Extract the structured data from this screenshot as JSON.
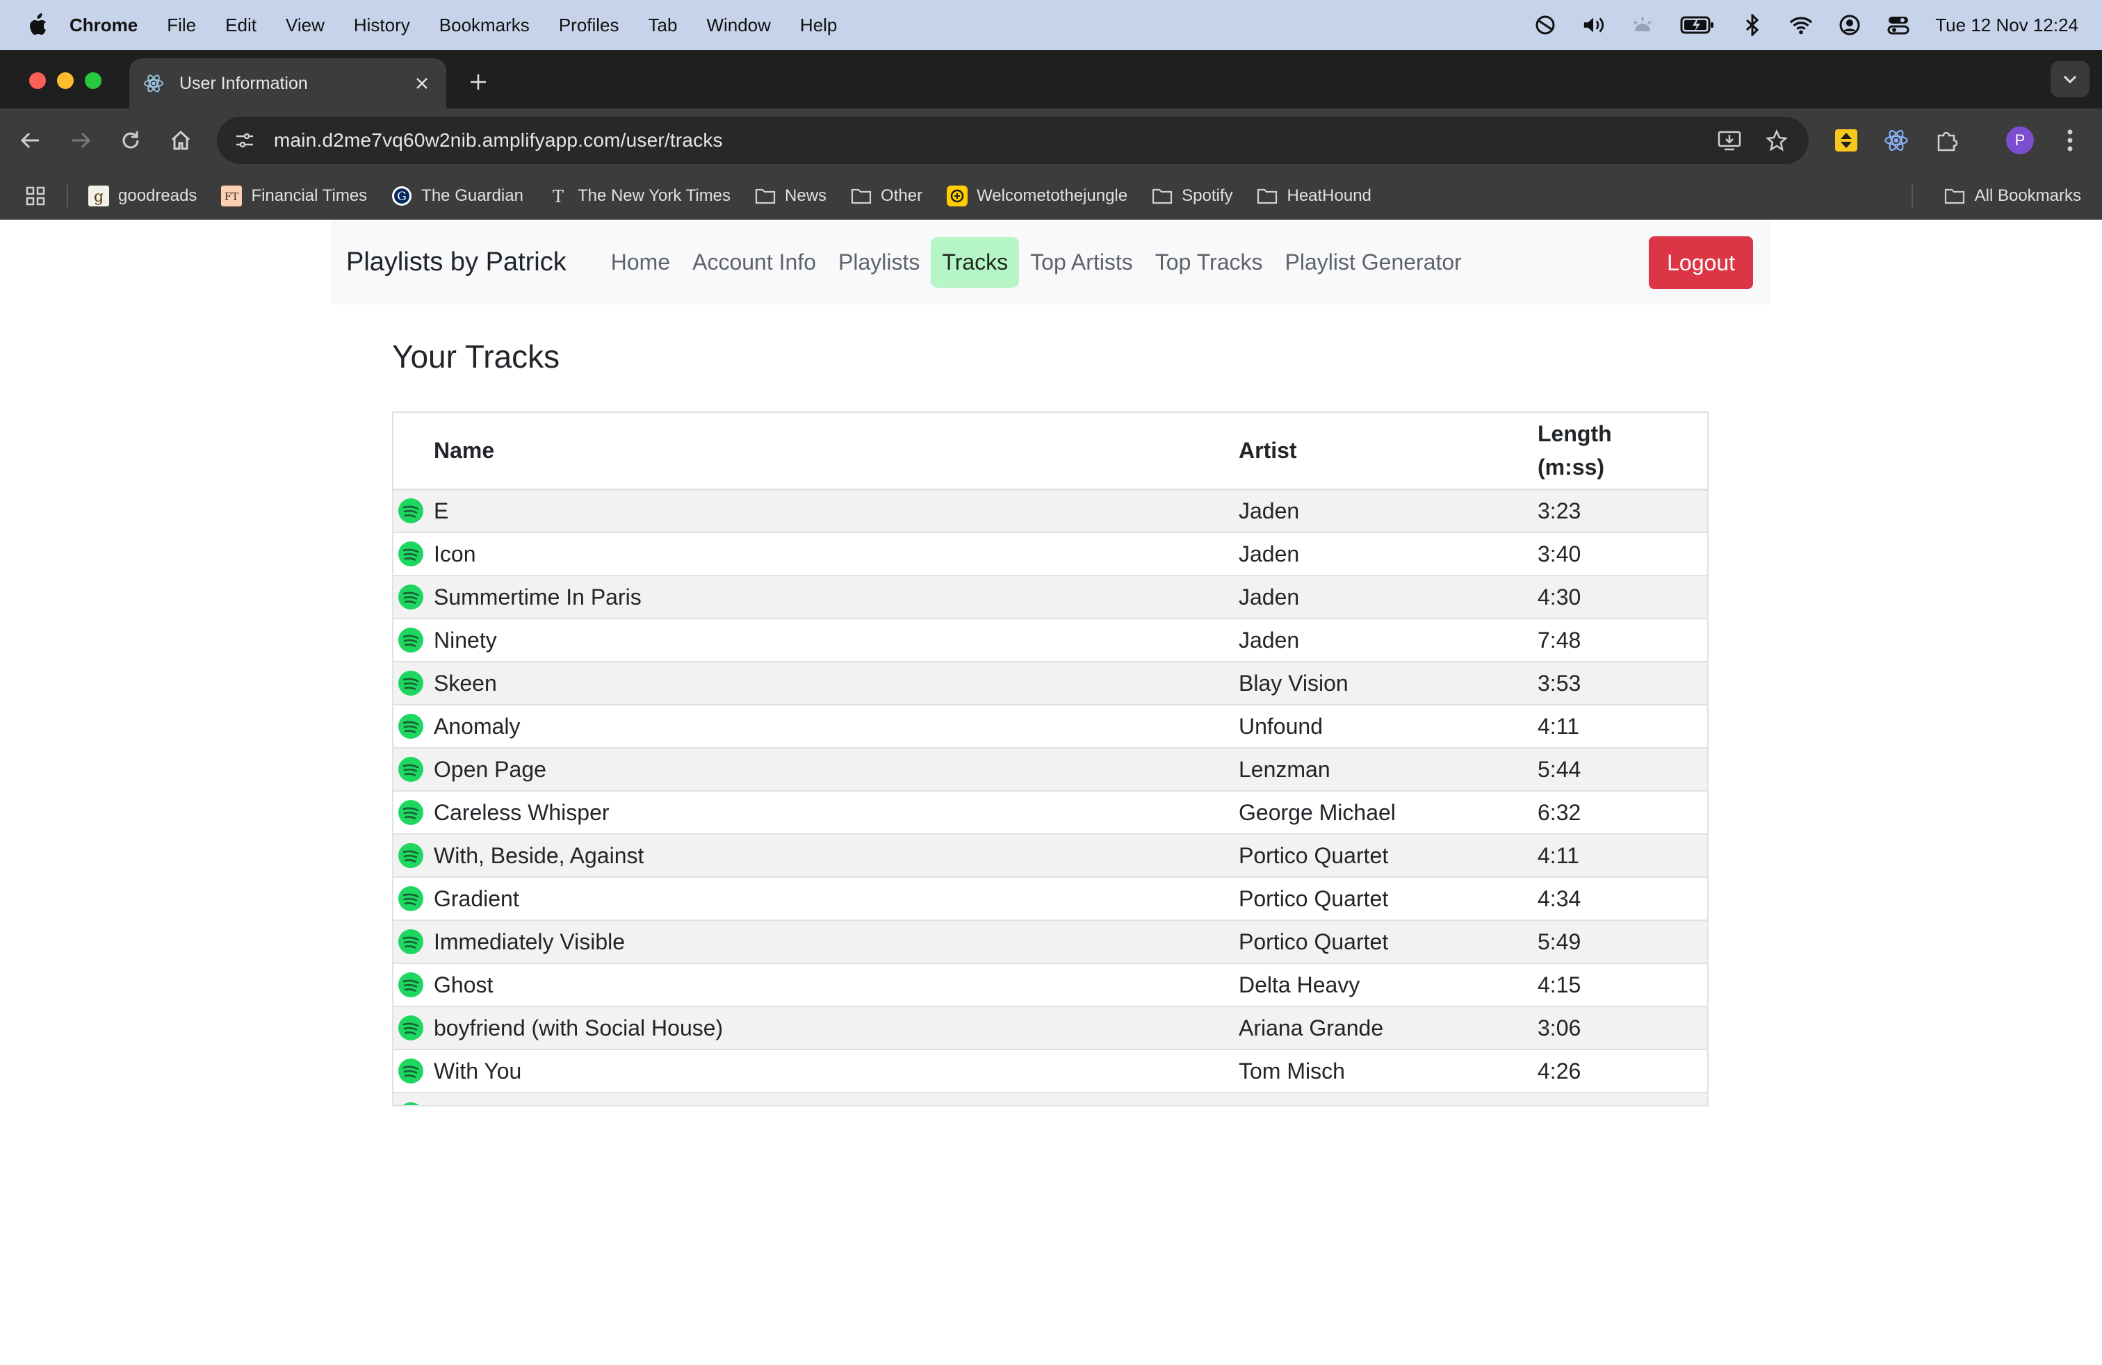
{
  "menubar": {
    "app": "Chrome",
    "items": [
      "File",
      "Edit",
      "View",
      "History",
      "Bookmarks",
      "Profiles",
      "Tab",
      "Window",
      "Help"
    ],
    "clock": "Tue 12 Nov  12:24"
  },
  "browser": {
    "tab_title": "User Information",
    "url": "main.d2me7vq60w2nib.amplifyapp.com/user/tracks",
    "bookmarks": [
      {
        "label": "goodreads",
        "icon": "goodreads-icon"
      },
      {
        "label": "Financial Times",
        "icon": "ft-icon"
      },
      {
        "label": "The Guardian",
        "icon": "guardian-icon"
      },
      {
        "label": "The New York Times",
        "icon": "nyt-icon"
      },
      {
        "label": "News",
        "icon": "folder-icon"
      },
      {
        "label": "Other",
        "icon": "folder-icon"
      },
      {
        "label": "Welcometothejungle",
        "icon": "wttj-icon"
      },
      {
        "label": "Spotify",
        "icon": "folder-icon"
      },
      {
        "label": "HeatHound",
        "icon": "folder-icon"
      }
    ],
    "all_bookmarks": "All Bookmarks",
    "profile_initial": "P"
  },
  "navbar": {
    "brand": "Playlists by Patrick",
    "links": [
      "Home",
      "Account Info",
      "Playlists",
      "Tracks",
      "Top Artists",
      "Top Tracks",
      "Playlist Generator"
    ],
    "active": "Tracks",
    "logout": "Logout"
  },
  "page": {
    "heading": "Your Tracks"
  },
  "table": {
    "columns": [
      "Name",
      "Artist",
      "Length (m:ss)"
    ],
    "rows": [
      {
        "name": "E",
        "artist": "Jaden",
        "length": "3:23"
      },
      {
        "name": "Icon",
        "artist": "Jaden",
        "length": "3:40"
      },
      {
        "name": "Summertime In Paris",
        "artist": "Jaden",
        "length": "4:30"
      },
      {
        "name": "Ninety",
        "artist": "Jaden",
        "length": "7:48"
      },
      {
        "name": "Skeen",
        "artist": "Blay Vision",
        "length": "3:53"
      },
      {
        "name": "Anomaly",
        "artist": "Unfound",
        "length": "4:11"
      },
      {
        "name": "Open Page",
        "artist": "Lenzman",
        "length": "5:44"
      },
      {
        "name": "Careless Whisper",
        "artist": "George Michael",
        "length": "6:32"
      },
      {
        "name": "With, Beside, Against",
        "artist": "Portico Quartet",
        "length": "4:11"
      },
      {
        "name": "Gradient",
        "artist": "Portico Quartet",
        "length": "4:34"
      },
      {
        "name": "Immediately Visible",
        "artist": "Portico Quartet",
        "length": "5:49"
      },
      {
        "name": "Ghost",
        "artist": "Delta Heavy",
        "length": "4:15"
      },
      {
        "name": "boyfriend (with Social House)",
        "artist": "Ariana Grande",
        "length": "3:06"
      },
      {
        "name": "With You",
        "artist": "Tom Misch",
        "length": "4:26"
      },
      {
        "name": "",
        "artist": "",
        "length": ""
      }
    ]
  },
  "colors": {
    "active_nav": "#b6f5c6",
    "logout": "#dc3545",
    "spotify_green": "#1ed760"
  }
}
